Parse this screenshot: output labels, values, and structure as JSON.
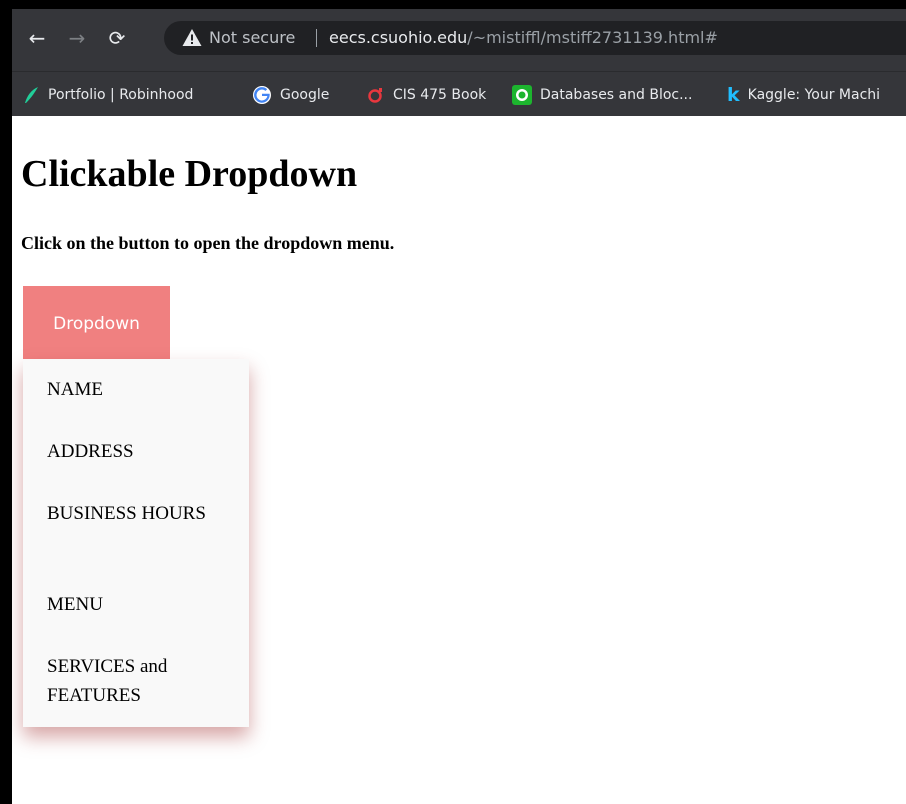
{
  "browser": {
    "nav": {
      "back_icon": "←",
      "forward_icon": "→",
      "reload_icon": "⟳"
    },
    "omnibox": {
      "security_label": "Not secure",
      "url_host": "eecs.csuohio.edu",
      "url_path": "/~mistiffl/mstiff2731139.html#"
    },
    "bookmarks": [
      {
        "label": "Portfolio | Robinhood",
        "icon": "robinhood-feather-icon",
        "color": "#21ce99"
      },
      {
        "label": "Google",
        "icon": "google-icon",
        "color": "#4285f4"
      },
      {
        "label": "CIS 475 Book",
        "icon": "book-icon",
        "color": "#e8373e"
      },
      {
        "label": "Databases and Bloc...",
        "icon": "database-icon",
        "color": "#1cb52e"
      },
      {
        "label": "Kaggle: Your Machi",
        "icon": "kaggle-icon",
        "color": "#20beff"
      }
    ]
  },
  "page": {
    "title": "Clickable Dropdown",
    "subtitle": "Click on the button to open the dropdown menu.",
    "dropdown_button": "Dropdown",
    "menu_items": [
      "NAME",
      "ADDRESS",
      "BUSINESS HOURS",
      "MENU",
      "SERVICES and FEATURES"
    ]
  },
  "colors": {
    "button_bg": "#f08080",
    "menu_bg": "#f9f9f9",
    "toolbar_bg": "#35363a",
    "omnibox_bg": "#202124"
  }
}
